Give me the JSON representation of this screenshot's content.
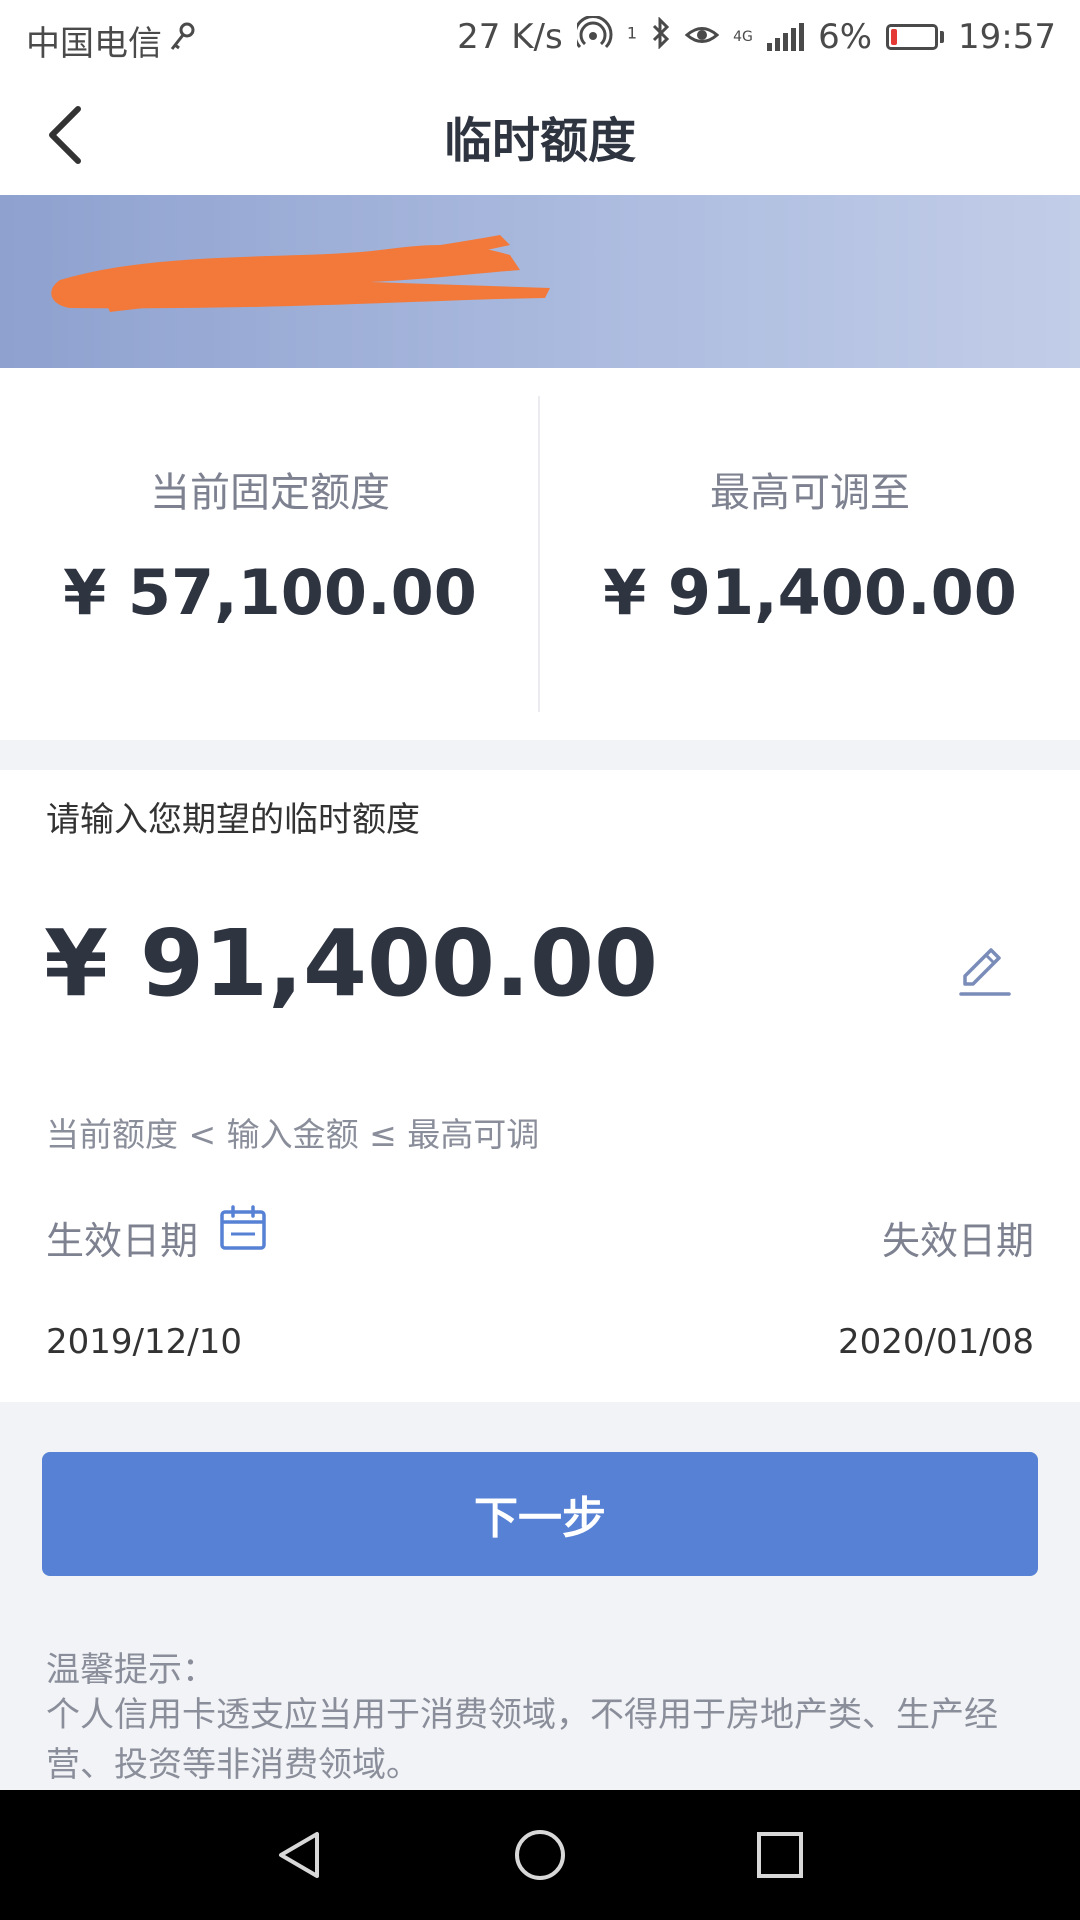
{
  "status_bar": {
    "carrier": "中国电信",
    "net_speed": "27 K/s",
    "hotspot_badge": "1",
    "network_type": "4G",
    "battery_percent": "6%",
    "time": "19:57",
    "battery_level": 0.06
  },
  "nav": {
    "title": "临时额度"
  },
  "quota": {
    "current_label": "当前固定额度",
    "current_value": "¥ 57,100.00",
    "max_label": "最高可调至",
    "max_value": "¥ 91,400.00"
  },
  "input": {
    "prompt": "请输入您期望的临时额度",
    "amount": "¥ 91,400.00",
    "hint": "当前额度 < 输入金额 ≤ 最高可调",
    "start_label": "生效日期",
    "end_label": "失效日期",
    "start_date": "2019/12/10",
    "end_date": "2020/01/08"
  },
  "actions": {
    "next_label": "下一步"
  },
  "tips": {
    "title": "温馨提示：",
    "body": "个人信用卡透支应当用于消费领域，不得用于房地产类、生产经营、投资等非消费领域。"
  },
  "colors": {
    "primary": "#5681d4",
    "banner_start": "#8ea1cf",
    "banner_end": "#c2cde8",
    "redaction": "#f2793a",
    "text_dark": "#2f3441",
    "text_muted": "#8a8e9a"
  },
  "icons": {
    "back": "chevron-left-icon",
    "edit": "pencil-icon",
    "calendar": "calendar-icon",
    "sys_back": "triangle-back-icon",
    "sys_home": "circle-home-icon",
    "sys_recent": "square-recent-icon"
  }
}
